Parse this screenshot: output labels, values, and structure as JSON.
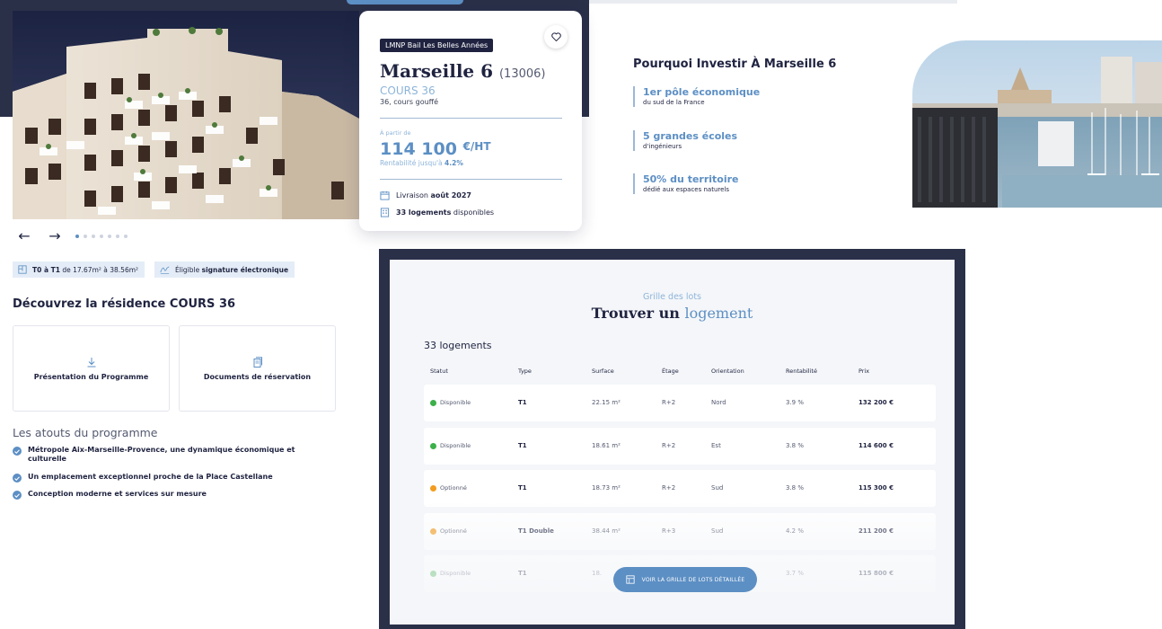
{
  "colors": {
    "navy": "#1f2340",
    "band": "#2b3049",
    "accent": "#5c8fc4",
    "accent_light": "#8db4d9",
    "status_available": "#3cb04a",
    "status_optioned": "#f39c1e"
  },
  "hero": {
    "prev_arrow": "←",
    "next_arrow": "→",
    "slide_count": 7,
    "active_slide": 1
  },
  "card": {
    "tag": "LMNP Bail Les Belles Années",
    "city": "Marseille 6",
    "zip": "(13006)",
    "residence": "COURS 36",
    "address": "36, cours gouffé",
    "from_label": "À partir de",
    "price_value": "114 100",
    "price_unit": "€/HT",
    "yield_label": "Rentabilité jusqu'à",
    "yield_value": "4.2%",
    "delivery_label": "Livraison",
    "delivery_value": "août 2027",
    "units_value": "33 logements",
    "units_label": "disponibles",
    "icons": [
      "heart-icon",
      "calendar-icon",
      "building-icon"
    ]
  },
  "why": {
    "title": "Pourquoi Investir À Marseille 6",
    "stats": [
      {
        "highlight": "1er pôle économique",
        "sub": "du sud de la France"
      },
      {
        "highlight": "5 grandes écoles",
        "sub": "d'ingénieurs"
      },
      {
        "highlight": "50% du territoire",
        "sub": "dédié aux espaces naturels"
      }
    ]
  },
  "chips": {
    "surface_bold": "T0 à T1",
    "surface_rest": "de 17.67m² à 38.56m²",
    "sign_prefix": "Éligible",
    "sign_bold": "signature électronique"
  },
  "discover": {
    "title": "Découvrez la résidence COURS 36",
    "presentation_label": "Présentation du Programme",
    "documents_label": "Documents de réservation"
  },
  "atouts": {
    "title": "Les atouts du programme",
    "items": [
      "Métropole Aix-Marseille-Provence, une dynamique économique et culturelle",
      "Un emplacement exceptionnel proche de la Place Castellane",
      "Conception moderne et services sur mesure"
    ]
  },
  "grid": {
    "subtitle": "Grille des lots",
    "title_part1": "Trouver un",
    "title_part2": "logement",
    "count": "33 logements",
    "headers": [
      "Statut",
      "Type",
      "Surface",
      "Étage",
      "Orientation",
      "Rentabilité",
      "Prix"
    ],
    "rows": [
      {
        "status": "Disponible",
        "type": "T1",
        "surface": "22.15 m²",
        "floor": "R+2",
        "orientation": "Nord",
        "yield": "3.9 %",
        "price": "132 200 €"
      },
      {
        "status": "Disponible",
        "type": "T1",
        "surface": "18.61 m²",
        "floor": "R+2",
        "orientation": "Est",
        "yield": "3.8 %",
        "price": "114 600 €"
      },
      {
        "status": "Optionné",
        "type": "T1",
        "surface": "18.73 m²",
        "floor": "R+2",
        "orientation": "Sud",
        "yield": "3.8 %",
        "price": "115 300 €"
      },
      {
        "status": "Optionné",
        "type": "T1 Double",
        "surface": "38.44 m²",
        "floor": "R+3",
        "orientation": "Sud",
        "yield": "4.2 %",
        "price": "211 200 €"
      },
      {
        "status": "Disponible",
        "type": "T1",
        "surface": "18.",
        "floor": "",
        "orientation": "",
        "yield": "3.7 %",
        "price": "115 800 €"
      }
    ],
    "cta": "VOIR LA GRILLE DE LOTS DÉTAILLÉE"
  }
}
